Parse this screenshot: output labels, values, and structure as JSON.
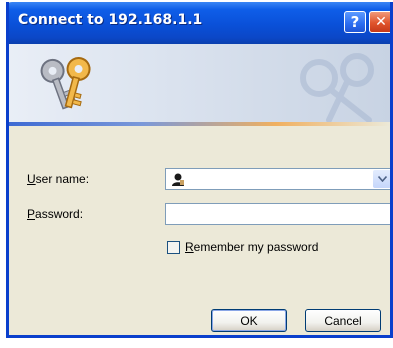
{
  "window": {
    "title": "Connect to 192.168.1.1",
    "help_label": "?",
    "close_label": "✕"
  },
  "form": {
    "username_label_u": "U",
    "username_label_rest": "ser name:",
    "username_value": "",
    "password_label_u": "P",
    "password_label_rest": "assword:",
    "password_value": "",
    "remember_u": "R",
    "remember_rest": "emember my password",
    "remember_checked": false
  },
  "buttons": {
    "ok_label": "OK",
    "cancel_label": "Cancel"
  },
  "icons": {
    "banner": "keys-icon",
    "user": "user-icon",
    "dropdown": "chevron-down-icon"
  },
  "colors": {
    "titlebar": "#0a50d8",
    "dialog_bg": "#ece9d8",
    "close": "#e0542c",
    "border": "#7f9db9"
  }
}
